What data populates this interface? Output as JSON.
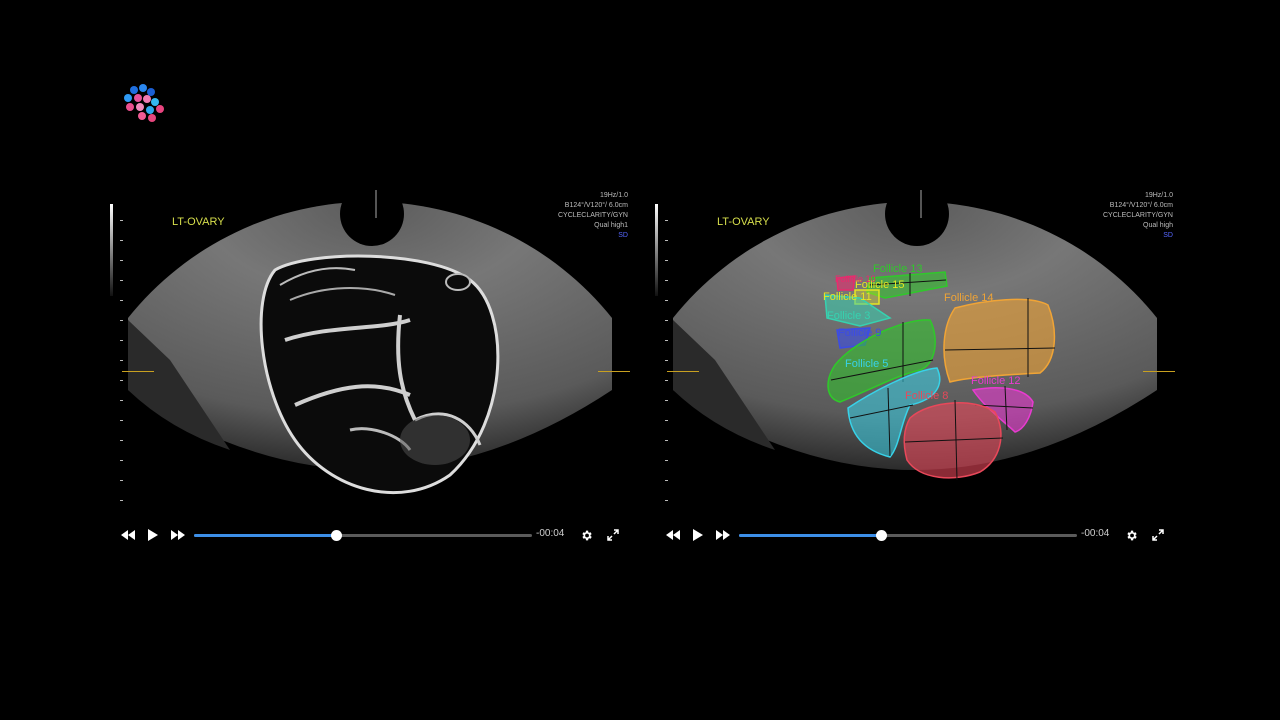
{
  "logo": {
    "icon": "dot-cluster-logo",
    "dots": [
      {
        "color": "#1f6fe0"
      },
      {
        "color": "#2a86ef"
      },
      {
        "color": "#1b5fd4"
      },
      {
        "color": "#2e9af5"
      },
      {
        "color": "#e8529a"
      },
      {
        "color": "#f07ab3"
      },
      {
        "color": "#35b7f0"
      },
      {
        "color": "#ea4f8e"
      },
      {
        "color": "#f38bbd"
      },
      {
        "color": "#2fa8ee"
      },
      {
        "color": "#e9447f"
      },
      {
        "color": "#f05b94"
      },
      {
        "color": "#e6467d"
      }
    ]
  },
  "players": [
    {
      "view_label": "LT-OVARY",
      "scan_info": [
        "19Hz/1.0",
        "B124°/V120°/ 6.0cm",
        "CYCLECLARITY/GYN",
        "Qual high1",
        "SD"
      ],
      "progress": 0.42,
      "time": "-00:04",
      "controls": {
        "rewind": "rewind-icon",
        "play": "play-icon",
        "forward": "fast-forward-icon",
        "settings": "gear-icon",
        "fullscreen": "fullscreen-icon"
      }
    },
    {
      "view_label": "LT-OVARY",
      "scan_info": [
        "19Hz/1.0",
        "B124°/V120°/ 6.0cm",
        "CYCLECLARITY/GYN",
        "Qual high",
        "SD"
      ],
      "progress": 0.42,
      "time": "-00:04",
      "controls": {
        "rewind": "rewind-icon",
        "play": "play-icon",
        "forward": "fast-forward-icon",
        "settings": "gear-icon",
        "fullscreen": "fullscreen-icon"
      }
    }
  ],
  "follicles": [
    {
      "label": "Follicle 13",
      "color": "#2fc92a"
    },
    {
      "label": "Follicle 15",
      "color": "#e6e622"
    },
    {
      "label": "Follicle 11",
      "color": "#e6e622"
    },
    {
      "label": "Follicle 3",
      "color": "#36d2b0"
    },
    {
      "label": "Follicle 9",
      "color": "#3b4ce6"
    },
    {
      "label": "Follicle 14",
      "color": "#f0a436"
    },
    {
      "label": "Follicle 5",
      "color": "#38d2e8"
    },
    {
      "label": "Follicle 12",
      "color": "#e83bd0"
    },
    {
      "label": "Follicle 8",
      "color": "#e8485a"
    },
    {
      "label": "Follicle 10",
      "color": "#e82b6e"
    }
  ]
}
